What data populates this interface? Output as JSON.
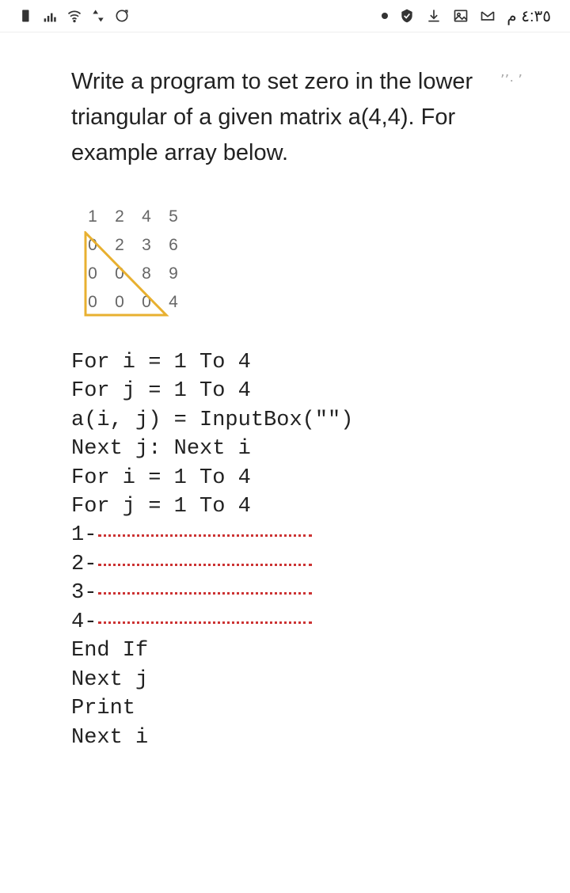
{
  "status": {
    "clock": "٤:٣٥ م"
  },
  "top_right": "٬ ·٬٬",
  "question": "Write a program to set zero in the lower triangular of a given matrix a(4,4). For example array below.",
  "matrix": {
    "rows": [
      [
        "1",
        "2",
        "4",
        "5"
      ],
      [
        "0",
        "2",
        "3",
        "6"
      ],
      [
        "0",
        "0",
        "8",
        "9"
      ],
      [
        "0",
        "0",
        "0",
        "4"
      ]
    ]
  },
  "code_lines_top": [
    "For i = 1 To 4",
    "For j = 1 To 4",
    "a(i, j) = InputBox(\"\")",
    "Next j: Next i",
    "For i = 1 To 4",
    "For j = 1 To 4"
  ],
  "blanks": [
    "1-",
    "2-",
    "3-",
    "4-"
  ],
  "code_lines_bottom": [
    "End If",
    "Next j",
    "Print",
    "Next i"
  ]
}
